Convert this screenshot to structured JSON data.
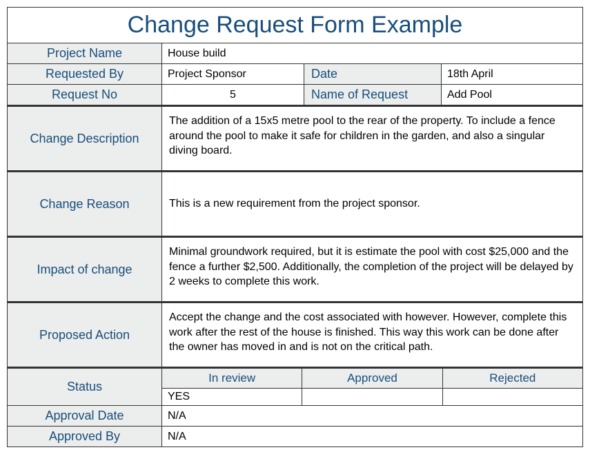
{
  "title": "Change Request Form Example",
  "labels": {
    "project_name": "Project Name",
    "requested_by": "Requested By",
    "date": "Date",
    "request_no": "Request No",
    "name_of_request": "Name of Request",
    "change_description": "Change Description",
    "change_reason": "Change Reason",
    "impact_of_change": "Impact of change",
    "proposed_action": "Proposed Action",
    "status": "Status",
    "approval_date": "Approval Date",
    "approved_by": "Approved By"
  },
  "values": {
    "project_name": "House build",
    "requested_by": "Project Sponsor",
    "date": "18th April",
    "request_no": "5",
    "name_of_request": "Add Pool",
    "change_description": "The addition of a 15x5 metre pool to the rear of the property. To include a fence around the pool to make it safe for children in the garden, and also a singular diving board.",
    "change_reason": "This is a new requirement from the project sponsor.",
    "impact_of_change": "Minimal groundwork required, but it is estimate the pool with cost $25,000 and the fence a further $2,500. Additionally, the completion of the project will be delayed by 2 weeks to complete this work.",
    "proposed_action": "Accept the change and the cost associated with however. However, complete this work after the rest of the house is finished. This way this work can be done after the owner has moved in and is not on the critical path.",
    "approval_date": "N/A",
    "approved_by": "N/A"
  },
  "status": {
    "headers": {
      "in_review": "In review",
      "approved": "Approved",
      "rejected": "Rejected"
    },
    "values": {
      "in_review": "YES",
      "approved": "",
      "rejected": ""
    }
  }
}
